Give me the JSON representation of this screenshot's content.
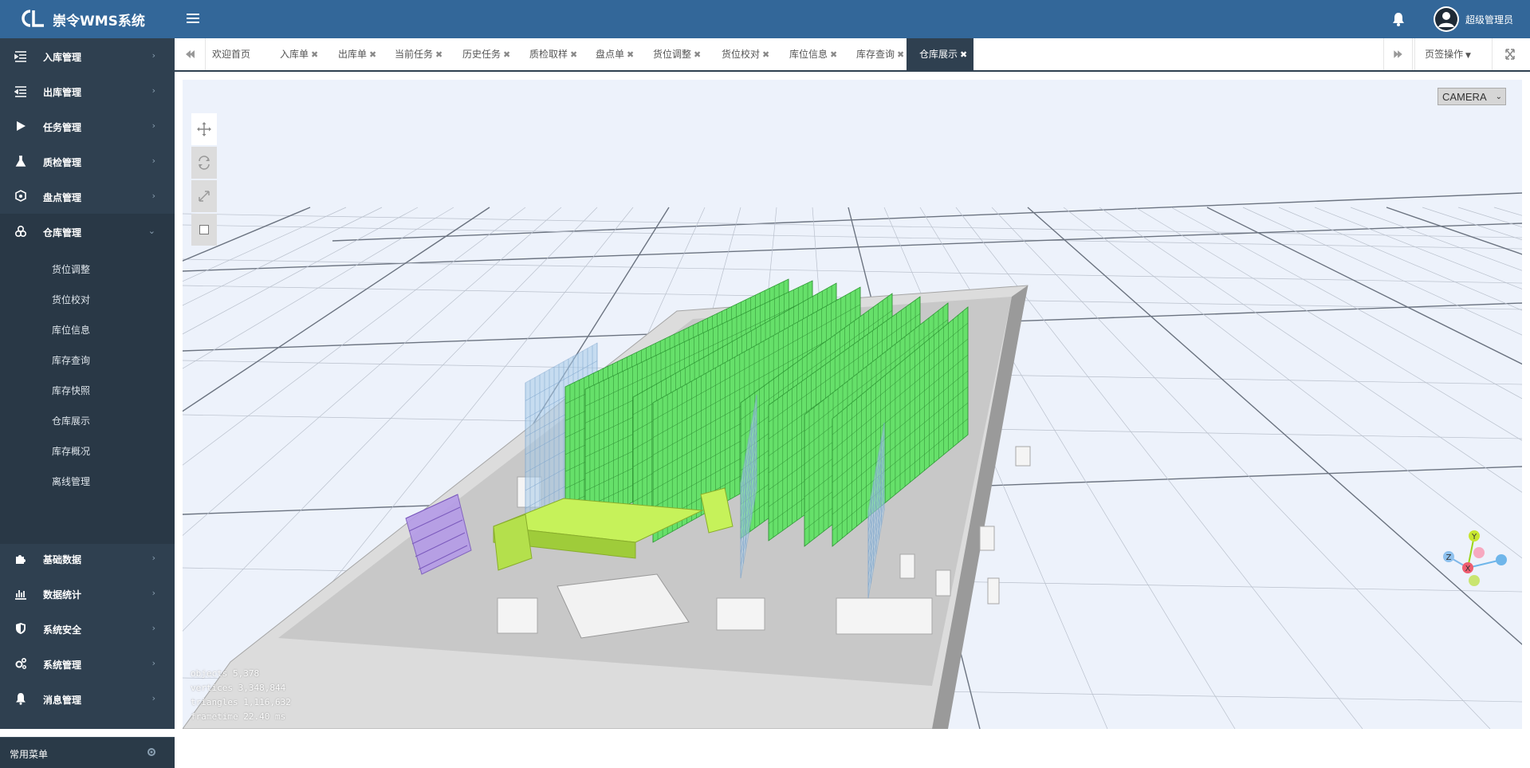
{
  "app": {
    "title": "崇令WMS系统",
    "logo_text": "CL",
    "user": "超级管理员"
  },
  "sidebar": {
    "items": [
      {
        "label": "入库管理",
        "icon": "indent-list-icon"
      },
      {
        "label": "出库管理",
        "icon": "outdent-list-icon"
      },
      {
        "label": "任务管理",
        "icon": "play-icon"
      },
      {
        "label": "质检管理",
        "icon": "flask-icon"
      },
      {
        "label": "盘点管理",
        "icon": "cubes-icon"
      },
      {
        "label": "仓库管理",
        "icon": "boxes-icon",
        "expanded": true
      },
      {
        "label": "基础数据",
        "icon": "puzzle-icon"
      },
      {
        "label": "数据统计",
        "icon": "bar-chart-icon"
      },
      {
        "label": "系统安全",
        "icon": "shield-icon"
      },
      {
        "label": "系统管理",
        "icon": "cogs-icon"
      },
      {
        "label": "消息管理",
        "icon": "bell-icon"
      }
    ],
    "submenu": [
      "货位调整",
      "货位校对",
      "库位信息",
      "库存查询",
      "库存快照",
      "仓库展示",
      "库存概况",
      "离线管理"
    ],
    "favorites_label": "常用菜单"
  },
  "tabs": {
    "home": "欢迎首页",
    "items": [
      "入库单",
      "出库单",
      "当前任务",
      "历史任务",
      "质检取样",
      "盘点单",
      "货位调整",
      "货位校对",
      "库位信息",
      "库存查询",
      "仓库展示"
    ],
    "active": "仓库展示",
    "close_glyph": "✖",
    "ops_label": "页签操作"
  },
  "viewport": {
    "camera_label": "CAMERA",
    "stats": [
      "objects  5,378",
      "vertices  3,348,844",
      "triangles  1,116,632",
      "frametime  22.40 ms"
    ],
    "axis_labels": [
      "Y",
      "Z",
      "X"
    ],
    "colors": {
      "stocked": "#66e06a",
      "empty_rack": "#a8cbe8",
      "special_rack": "#b59be8",
      "conveyor": "#c6f25a",
      "floor": "#c8c8c8"
    }
  }
}
